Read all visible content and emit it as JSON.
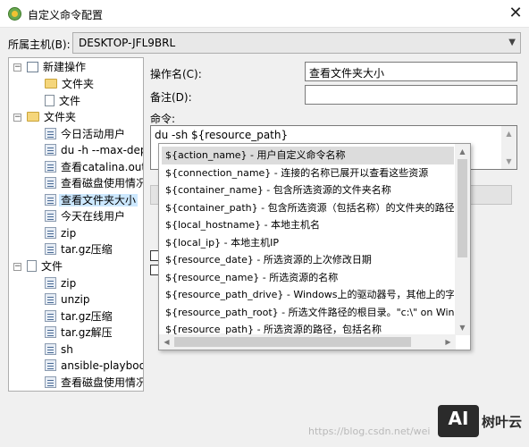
{
  "window": {
    "title": "自定义命令配置",
    "close_glyph": "✕"
  },
  "host": {
    "label": "所属主机(B):",
    "value": "DESKTOP-JFL9BRL"
  },
  "tree": {
    "new_op": {
      "label": "新建操作",
      "children": [
        "文件夹",
        "文件"
      ]
    },
    "folder": {
      "label": "文件夹",
      "items": [
        "今日活动用户",
        "du -h --max-dept",
        "查看catalina.out",
        "查看磁盘使用情况",
        "查看文件夹大小",
        "今天在线用户",
        "zip",
        "tar.gz压缩"
      ]
    },
    "file": {
      "label": "文件",
      "items": [
        "zip",
        "unzip",
        "tar.gz压缩",
        "tar.gz解压",
        "sh",
        "ansible-playboo",
        "查看磁盘使用情况"
      ]
    },
    "selected": "查看文件夹大小"
  },
  "form": {
    "name_label": "操作名(C):",
    "name_value": "查看文件夹大小",
    "note_label": "备注(D):",
    "note_value": "",
    "cmd_label": "命令:",
    "cmd_value": "du -sh ${resource_path}"
  },
  "autocomplete": {
    "items": [
      "${action_name} - 用户自定义命令名称",
      "${connection_name} - 连接的名称已展开以查看这些资源",
      "${container_name} - 包含所选资源的文件夹名称",
      "${container_path} - 包含所选资源（包括名称）的文件夹的路径",
      "${local_hostname} - 本地主机名",
      "${local_ip} - 本地主机IP",
      "${resource_date} - 所选资源的上次修改日期",
      "${resource_name} - 所选资源的名称",
      "${resource_path_drive} - Windows上的驱动器号，其他上的字符",
      "${resource_path_root} - 所选文件路径的根目录。\"c:\\\" on Windo",
      "${resource_path} - 所选资源的路径，包括名称"
    ],
    "active_index": 0
  },
  "footer": {
    "watermark": "https://blog.csdn.net/wei",
    "logo_text": "AI",
    "brand": "树叶云"
  }
}
